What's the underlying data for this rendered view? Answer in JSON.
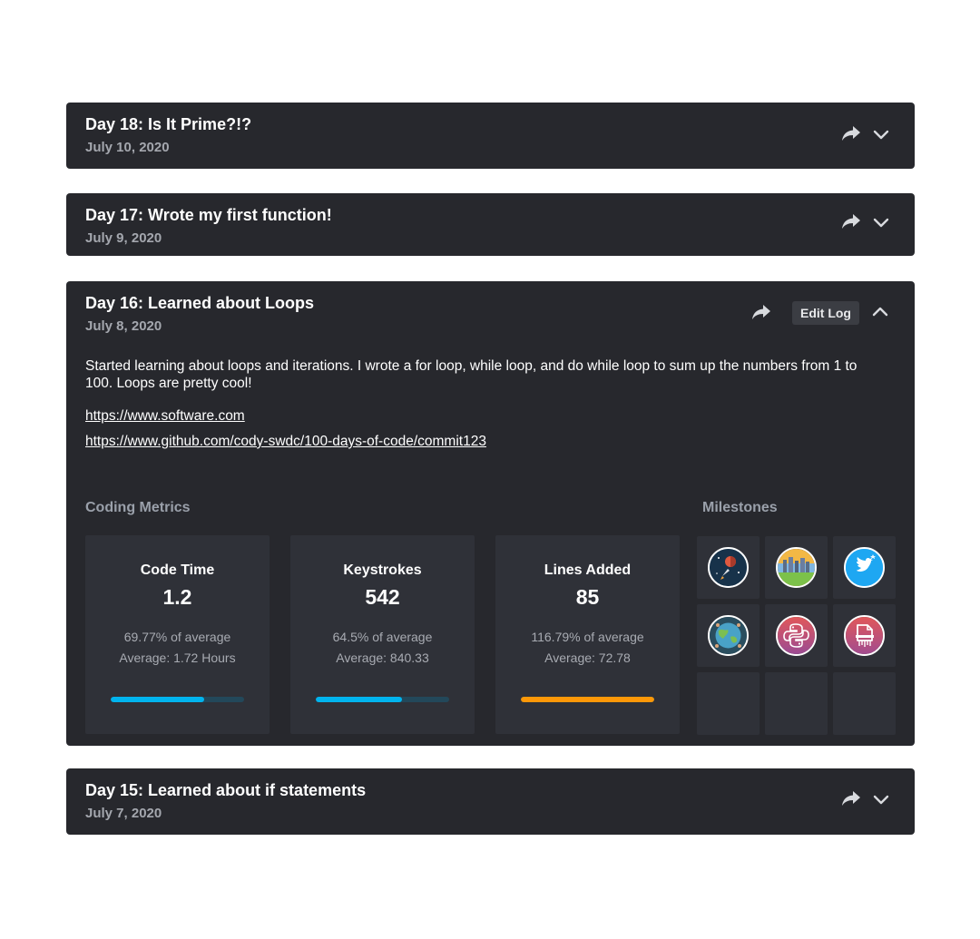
{
  "logs": [
    {
      "title": "Day 18: Is It Prime?!?",
      "date": "July 10, 2020"
    },
    {
      "title": "Day 17: Wrote my first function!",
      "date": "July 9, 2020"
    },
    {
      "title": "Day 16: Learned about Loops",
      "date": "July 8, 2020",
      "edit_label": "Edit Log",
      "description": "Started learning about loops and iterations. I wrote a for loop, while loop, and do while loop to sum up the numbers from 1 to 100. Loops are pretty cool!",
      "links": [
        "https://www.software.com",
        "https://www.github.com/cody-swdc/100-days-of-code/commit123"
      ],
      "metrics_heading": "Coding Metrics",
      "milestones_heading": "Milestones",
      "metrics": [
        {
          "label": "Code Time",
          "value": "1.2",
          "percent_text": "69.77% of average",
          "average_text": "Average: 1.72 Hours",
          "progress": 0.6977,
          "color": "#00b4ee"
        },
        {
          "label": "Keystrokes",
          "value": "542",
          "percent_text": "64.5% of average",
          "average_text": "Average: 840.33",
          "progress": 0.645,
          "color": "#00b4ee"
        },
        {
          "label": "Lines Added",
          "value": "85",
          "percent_text": "116.79% of average",
          "average_text": "Average: 72.78",
          "progress": 1.0,
          "color": "#fd9808"
        }
      ],
      "milestones": [
        {
          "icon": "space-rocket-icon"
        },
        {
          "icon": "city-landscape-icon"
        },
        {
          "icon": "twitter-bird-icon"
        },
        {
          "icon": "globe-icon"
        },
        {
          "icon": "python-logo-icon"
        },
        {
          "icon": "document-file-icon"
        },
        {
          "icon": ""
        },
        {
          "icon": ""
        },
        {
          "icon": ""
        }
      ]
    },
    {
      "title": "Day 15: Learned about if statements",
      "date": "July 7, 2020"
    }
  ],
  "colors": {
    "card_background": "#27282d",
    "tile_background": "#2f3138",
    "progress_track": "#23485a",
    "progress_blue": "#00b4ee",
    "progress_orange": "#fd9808"
  }
}
